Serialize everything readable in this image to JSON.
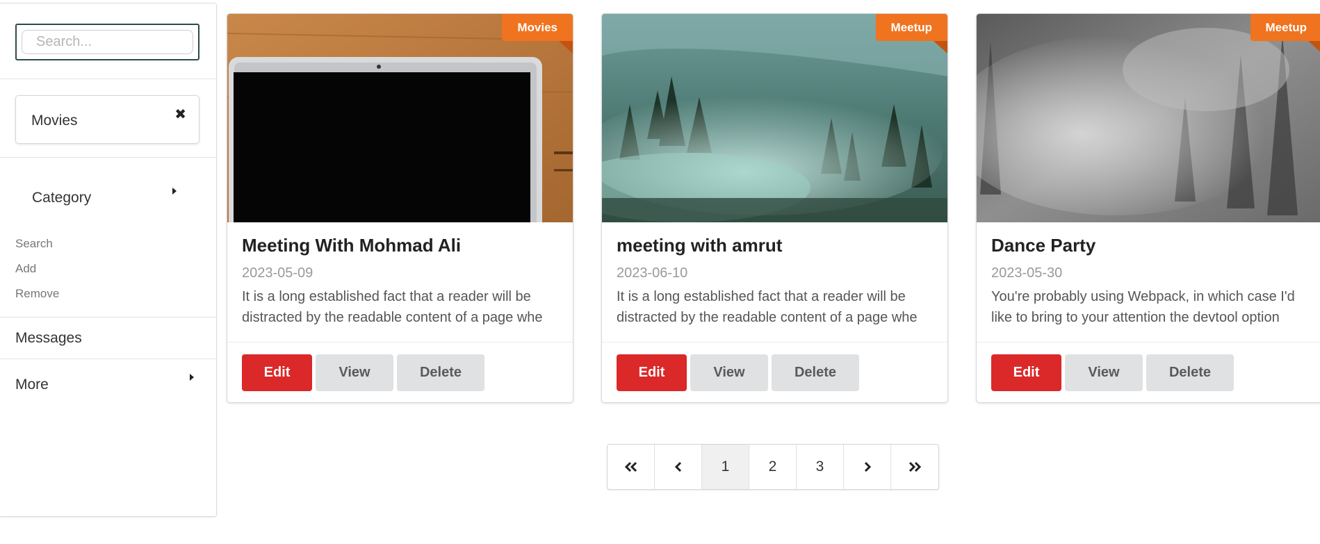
{
  "sidebar": {
    "search_placeholder": "Search...",
    "filter_chip": {
      "label": "Movies"
    },
    "category": {
      "label": "Category",
      "items": [
        "Search",
        "Add",
        "Remove"
      ]
    },
    "messages_label": "Messages",
    "more_label": "More"
  },
  "cards": [
    {
      "tag": "Movies",
      "title": "Meeting With Mohmad Ali",
      "date": "2023-05-09",
      "description": "It is a long established fact that a reader will be distracted by the readable content of a page whe",
      "edit_label": "Edit",
      "view_label": "View",
      "delete_label": "Delete"
    },
    {
      "tag": "Meetup",
      "title": "meeting with amrut",
      "date": "2023-06-10",
      "description": "It is a long established fact that a reader will be distracted by the readable content of a page whe",
      "edit_label": "Edit",
      "view_label": "View",
      "delete_label": "Delete"
    },
    {
      "tag": "Meetup",
      "title": "Dance Party",
      "date": "2023-05-30",
      "description": "You're probably using Webpack, in which case I'd like to bring to your attention the devtool option",
      "edit_label": "Edit",
      "view_label": "View",
      "delete_label": "Delete"
    }
  ],
  "pagination": {
    "pages": [
      "1",
      "2",
      "3"
    ],
    "active_page": "1"
  },
  "colors": {
    "ribbon": "#f0731f",
    "edit_button": "#db2828",
    "secondary_button": "#e0e1e2"
  }
}
